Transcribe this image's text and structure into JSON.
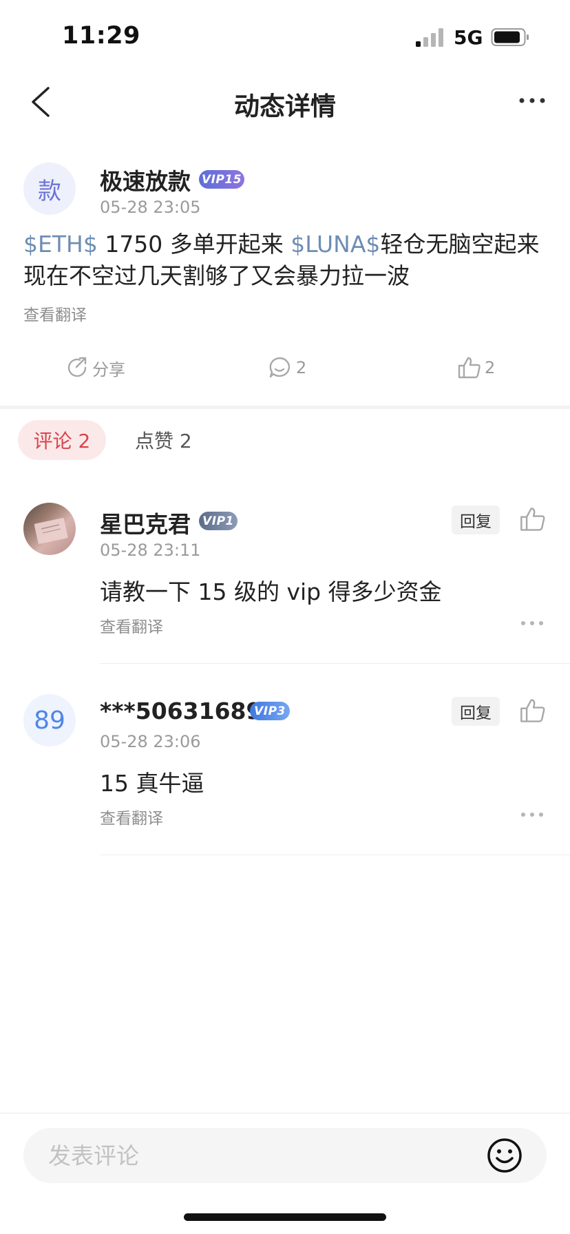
{
  "status_bar": {
    "time": "11:29",
    "network": "5G"
  },
  "nav": {
    "title": "动态详情"
  },
  "post": {
    "avatar_text": "款",
    "author": "极速放款",
    "vip": "VIP15",
    "time": "05-28 23:05",
    "tag1": "$ETH$",
    "text1": " 1750 多单开起来  ",
    "tag2": "$LUNA$",
    "text2": "轻仓无脑空起来现在不空过几天割够了又会暴力拉一波",
    "translate": "查看翻译",
    "share_label": "分享",
    "comment_count": "2",
    "like_count": "2"
  },
  "tabs": {
    "comments": "评论 2",
    "likes": "点赞 2"
  },
  "comments": [
    {
      "author": "星巴克君",
      "vip": "VIP1",
      "time": "05-28 23:11",
      "text": "请教一下 15 级的 vip 得多少资金",
      "translate": "查看翻译",
      "reply": "回复"
    },
    {
      "avatar_text": "89",
      "author": "***50631689",
      "vip": "VIP3",
      "time": "05-28 23:06",
      "text": "15 真牛逼",
      "translate": "查看翻译",
      "reply": "回复"
    }
  ],
  "input": {
    "placeholder": "发表评论"
  },
  "colors": {
    "accent_red": "#d9434b",
    "link_blue": "#6e8db4",
    "vip_purple": "#6c74d6"
  }
}
